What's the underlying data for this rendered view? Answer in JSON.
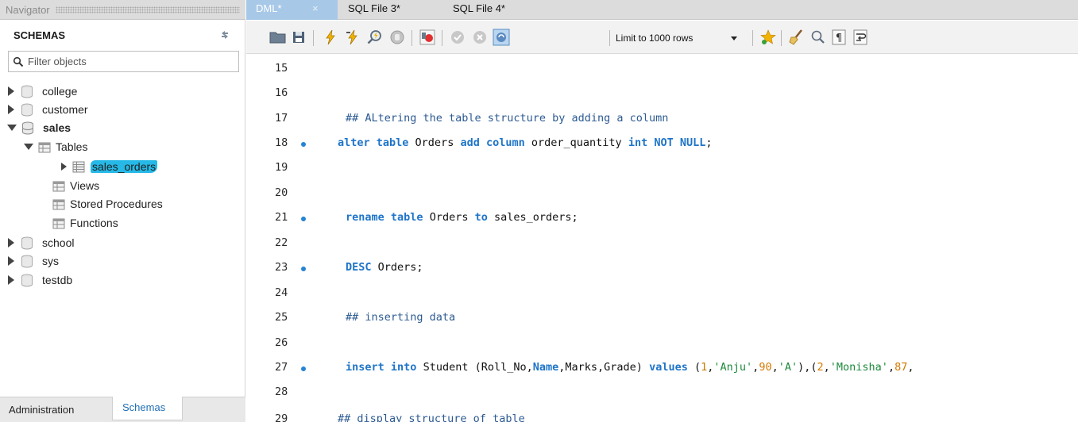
{
  "navigator": {
    "title": "Navigator",
    "schemas_label": "SCHEMAS",
    "filter_placeholder": "Filter objects",
    "tree": [
      {
        "label": "college"
      },
      {
        "label": "customer"
      },
      {
        "label": "sales"
      },
      {
        "label": "Tables"
      },
      {
        "label": "sales_orders"
      },
      {
        "label": "Views"
      },
      {
        "label": "Stored Procedures"
      },
      {
        "label": "Functions"
      },
      {
        "label": "school"
      },
      {
        "label": "sys"
      },
      {
        "label": "testdb"
      }
    ],
    "bottom_tabs": {
      "admin": "Administration",
      "schemas": "Schemas"
    }
  },
  "editor_tabs": [
    {
      "label": "DML*",
      "close": "×"
    },
    {
      "label": "SQL File 3*"
    },
    {
      "label": "SQL File 4*"
    }
  ],
  "toolbar": {
    "limit_value": "Limit to 1000 rows"
  },
  "code": {
    "line_numbers": [
      "15",
      "16",
      "17",
      "18",
      "19",
      "20",
      "21",
      "22",
      "23",
      "24",
      "25",
      "26",
      "27",
      "28",
      "29"
    ],
    "line17": "## ALtering the table structure by adding a column",
    "line18": {
      "k1": "alter",
      "k2": "table",
      "t1": " Orders ",
      "k3": "add",
      "k4": "column",
      "t2": " order_quantity ",
      "k5": "int",
      "k6": "NOT",
      "k7": "NULL",
      "end": ";"
    },
    "line21": {
      "k1": "rename",
      "k2": "table",
      "t1": " Orders ",
      "k3": "to",
      "t2": " sales_orders;"
    },
    "line23": {
      "k1": "DESC",
      "t1": " Orders;"
    },
    "line25": "## inserting data",
    "line27": {
      "k1": "insert",
      "k2": "into",
      "t1": " Student (Roll_No,",
      "k3": "Name",
      "t2": ",Marks,Grade) ",
      "k4": "values",
      "p1": " (",
      "n1": "1",
      "c1": ",",
      "s1": "'Anju'",
      "c2": ",",
      "n2": "90",
      "c3": ",",
      "s2": "'A'",
      "p2": "),(",
      "n3": "2",
      "c4": ",",
      "s3": "'Monisha'",
      "c5": ",",
      "n4": "87",
      "c6": ","
    },
    "line29_partial": "## display structure of table"
  }
}
